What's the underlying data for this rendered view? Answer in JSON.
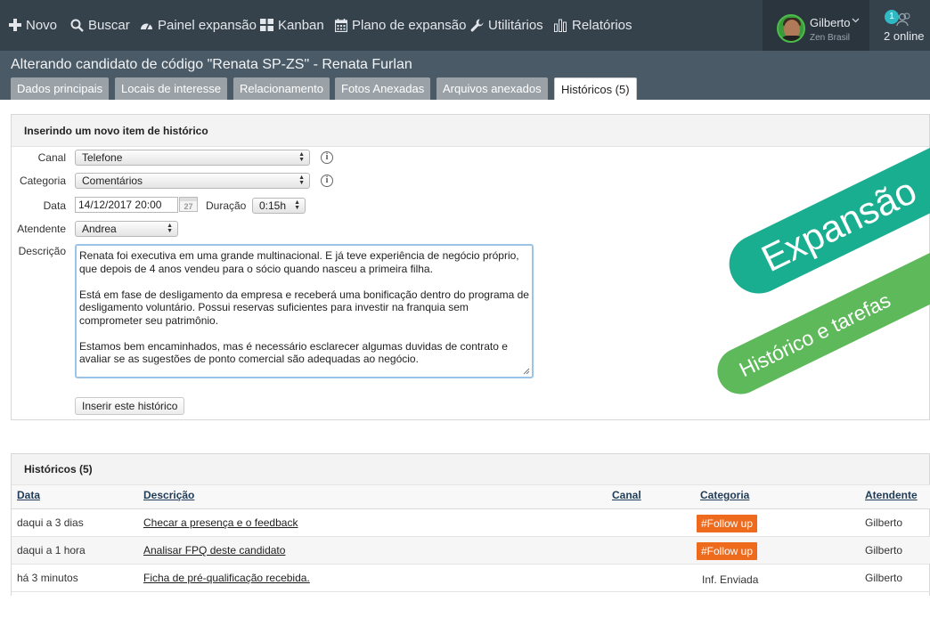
{
  "colors": {
    "topbar": "#35414b",
    "subheader": "#4a5a66",
    "tag": "#ee6a1c",
    "banner_primary": "#1aae91",
    "banner_secondary": "#5db95a"
  },
  "nav": {
    "items": [
      {
        "label": "Novo",
        "icon": "plus-icon"
      },
      {
        "label": "Buscar",
        "icon": "search-icon"
      },
      {
        "label": "Painel expansão",
        "icon": "dashboard-icon"
      },
      {
        "label": "Kanban",
        "icon": "kanban-icon"
      },
      {
        "label": "Plano de expansão",
        "icon": "calendar-icon"
      },
      {
        "label": "Utilitários",
        "icon": "wrench-icon"
      },
      {
        "label": "Relatórios",
        "icon": "bar-chart-icon"
      }
    ],
    "user": {
      "name": "Gilberto",
      "company": "Zen Brasil"
    },
    "online": {
      "badge": "1",
      "label": "2 online"
    }
  },
  "page_title": "Alterando candidato de código \"Renata SP-ZS\" - Renata Furlan",
  "tabs": [
    {
      "label": "Dados principais",
      "active": false
    },
    {
      "label": "Locais de interesse",
      "active": false
    },
    {
      "label": "Relacionamento",
      "active": false
    },
    {
      "label": "Fotos Anexadas",
      "active": false
    },
    {
      "label": "Arquivos anexados",
      "active": false
    },
    {
      "label": "Históricos (5)",
      "active": true
    }
  ],
  "form": {
    "heading": "Inserindo um novo item de histórico",
    "canal_label": "Canal",
    "canal_value": "Telefone",
    "categoria_label": "Categoria",
    "categoria_value": "Comentários",
    "data_label": "Data",
    "data_value": "14/12/2017 20:00",
    "calendar_day": "27",
    "duracao_label": "Duração",
    "duracao_value": "0:15h",
    "atendente_label": "Atendente",
    "atendente_value": "Andrea",
    "descricao_label": "Descrição",
    "descricao_paragraphs": [
      "Renata foi executiva em uma grande multinacional. E já teve experiência de negócio próprio, que depois de 4 anos vendeu para o sócio quando nasceu a primeira filha.",
      "Está em fase de desligamento da empresa e receberá uma bonificação dentro do programa de desligamento voluntário. Possui reservas suficientes para investir na franquia sem comprometer seu patrimônio.",
      "Estamos bem encaminhados, mas é necessário esclarecer algumas duvidas de contrato e avaliar se as sugestões de ponto comercial são adequadas ao negócio."
    ],
    "submit_label": "Inserir este histórico"
  },
  "banners": {
    "primary": "Expansão",
    "secondary": "Histórico e tarefas"
  },
  "historicos": {
    "heading": "Históricos (5)",
    "columns": [
      "Data",
      "Descrição",
      "Canal",
      "Categoria",
      "Atendente"
    ],
    "rows": [
      {
        "data": "daqui a 3 dias",
        "descricao": "Checar a presença e o feedback",
        "canal": "",
        "categoria": "#Follow up",
        "categoria_tag": true,
        "atendente": "Gilberto"
      },
      {
        "data": "daqui a 1 hora",
        "descricao": "Analisar FPQ deste candidato",
        "canal": "",
        "categoria": "#Follow up",
        "categoria_tag": true,
        "atendente": "Gilberto"
      },
      {
        "data": "há 3 minutos",
        "descricao": "Ficha de pré-qualificação recebida.",
        "canal": "",
        "categoria": "Inf. Enviada",
        "categoria_tag": false,
        "atendente": "Gilberto"
      }
    ]
  }
}
